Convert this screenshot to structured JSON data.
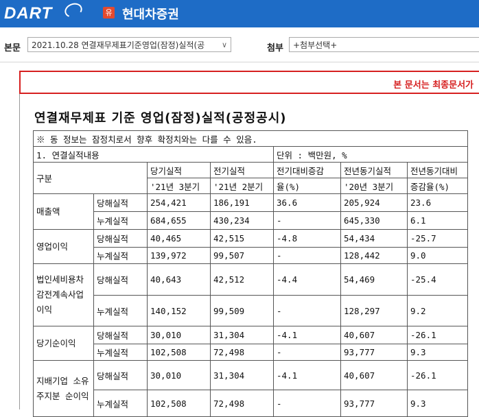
{
  "header": {
    "logo": "DART",
    "company_badge": "유",
    "company_name": "현대차증권"
  },
  "toolbar": {
    "main_label": "본문",
    "main_select": "2021.10.28  연결재무제표기준영업(잠정)실적(공",
    "attach_label": "첨부",
    "attach_select": "+첨부선택+"
  },
  "notice": "본 문서는 최종문서가",
  "document": {
    "title": "연결재무제표 기준 영업(잠정)실적(공정공시)",
    "note": "※ 동 정보는 잠정치로서 향후 확정치와는 다를 수 있음.",
    "section": "1. 연결실적내용",
    "unit": "단위 : 백만원, %",
    "headers": {
      "category": "구분",
      "current": "당기실적",
      "current_period": "'21년 3분기",
      "previous": "전기실적",
      "previous_period": "'21년 2분기",
      "qoq": "전기대비증감",
      "qoq_unit": "율(%)",
      "yoy_base": "전년동기실적",
      "yoy_base_period": "'20년 3분기",
      "yoy": "전년동기대비",
      "yoy_unit": "증감율(%)"
    },
    "groups": [
      {
        "name": "매출액",
        "rows": [
          {
            "sub": "당해실적",
            "cur": "254,421",
            "prev": "186,191",
            "qoq": "36.6",
            "ly": "205,924",
            "yoy": "23.6"
          },
          {
            "sub": "누계실적",
            "cur": "684,655",
            "prev": "430,234",
            "qoq": "-",
            "ly": "645,330",
            "yoy": "6.1"
          }
        ]
      },
      {
        "name": "영업이익",
        "rows": [
          {
            "sub": "당해실적",
            "cur": "40,465",
            "prev": "42,515",
            "qoq": "-4.8",
            "ly": "54,434",
            "yoy": "-25.7"
          },
          {
            "sub": "누계실적",
            "cur": "139,972",
            "prev": "99,507",
            "qoq": "-",
            "ly": "128,442",
            "yoy": "9.0"
          }
        ]
      },
      {
        "name": "법인세비용차감전계속사업이익",
        "rows": [
          {
            "sub": "당해실적",
            "cur": "40,643",
            "prev": "42,512",
            "qoq": "-4.4",
            "ly": "54,469",
            "yoy": "-25.4"
          },
          {
            "sub": "누계실적",
            "cur": "140,152",
            "prev": "99,509",
            "qoq": "-",
            "ly": "128,297",
            "yoy": "9.2"
          }
        ]
      },
      {
        "name": "당기순이익",
        "rows": [
          {
            "sub": "당해실적",
            "cur": "30,010",
            "prev": "31,304",
            "qoq": "-4.1",
            "ly": "40,607",
            "yoy": "-26.1"
          },
          {
            "sub": "누계실적",
            "cur": "102,508",
            "prev": "72,498",
            "qoq": "-",
            "ly": "93,777",
            "yoy": "9.3"
          }
        ]
      },
      {
        "name": "지배기업 소유주지분 순이익",
        "rows": [
          {
            "sub": "당해실적",
            "cur": "30,010",
            "prev": "31,304",
            "qoq": "-4.1",
            "ly": "40,607",
            "yoy": "-26.1"
          },
          {
            "sub": "누계실적",
            "cur": "102,508",
            "prev": "72,498",
            "qoq": "-",
            "ly": "93,777",
            "yoy": "9.3"
          }
        ]
      }
    ]
  }
}
